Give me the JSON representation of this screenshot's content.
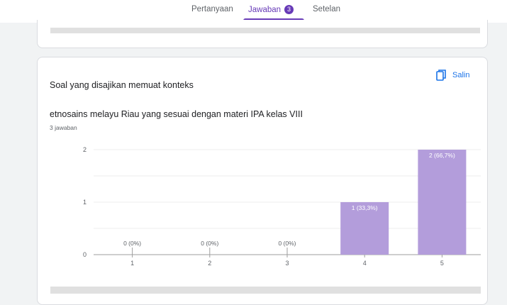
{
  "tabs": [
    {
      "label": "Pertanyaan",
      "active": false
    },
    {
      "label": "Jawaban",
      "active": true,
      "badge": "3"
    },
    {
      "label": "Setelan",
      "active": false
    }
  ],
  "question": {
    "title_line1": "Soal yang disajikan memuat konteks",
    "title_line2": "etnosains melayu Riau yang sesuai dengan materi IPA kelas VIII",
    "response_count": "3 jawaban",
    "copy_label": "Salin"
  },
  "colors": {
    "accent": "#673ab7",
    "bar": "#b39ddb",
    "link": "#1a73e8"
  },
  "chart_data": {
    "type": "bar",
    "categories": [
      "1",
      "2",
      "3",
      "4",
      "5"
    ],
    "values": [
      0,
      0,
      0,
      1,
      2
    ],
    "data_labels": [
      "0 (0%)",
      "0 (0%)",
      "0 (0%)",
      "1 (33,3%)",
      "2 (66,7%)"
    ],
    "yticks": [
      "0",
      "1",
      "2"
    ],
    "ylim": [
      0,
      2
    ],
    "grid": true
  }
}
